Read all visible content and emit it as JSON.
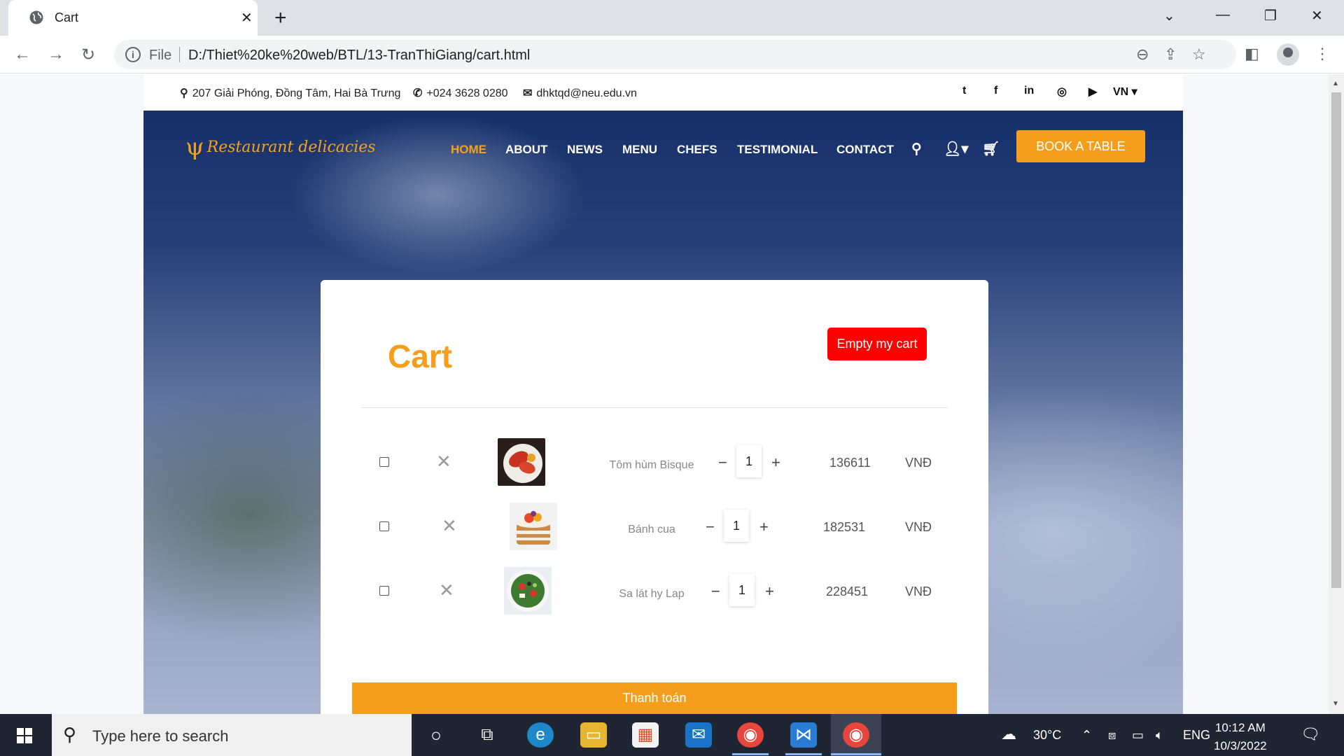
{
  "browser": {
    "tab_title": "Cart",
    "url_scheme": "File",
    "url": "D:/Thiet%20ke%20web/BTL/13-TranThiGiang/cart.html"
  },
  "topbar": {
    "address": "207 Giải Phóng, Đồng Tâm, Hai Bà Trưng",
    "phone": "+024 3628 0280",
    "email": "dhktqd@neu.edu.vn",
    "language": "VN"
  },
  "header": {
    "logo_text": "Restaurant delicacies",
    "nav": [
      "HOME",
      "ABOUT",
      "NEWS",
      "MENU",
      "CHEFS",
      "TESTIMONIAL",
      "CONTACT"
    ],
    "book_label": "BOOK A TABLE"
  },
  "cart": {
    "title": "Cart",
    "empty_label": "Empty my cart",
    "items": [
      {
        "name": "Tôm hùm Bisque",
        "qty": "1",
        "price": "136611",
        "currency": "VNĐ",
        "image": "lobster"
      },
      {
        "name": "Bánh cua",
        "qty": "1",
        "price": "182531",
        "currency": "VNĐ",
        "image": "cake"
      },
      {
        "name": "Sa lát hy Lap",
        "qty": "1",
        "price": "228451",
        "currency": "VNĐ",
        "image": "salad"
      }
    ],
    "checkout_label": "Thanh toán"
  },
  "taskbar": {
    "search_placeholder": "Type here to search",
    "weather": "30°C",
    "language": "ENG",
    "time": "10:12 AM",
    "date": "10/3/2022"
  },
  "colors": {
    "accent": "#f59e1b",
    "danger": "#ff0000",
    "nav_bg": "#17306a"
  }
}
